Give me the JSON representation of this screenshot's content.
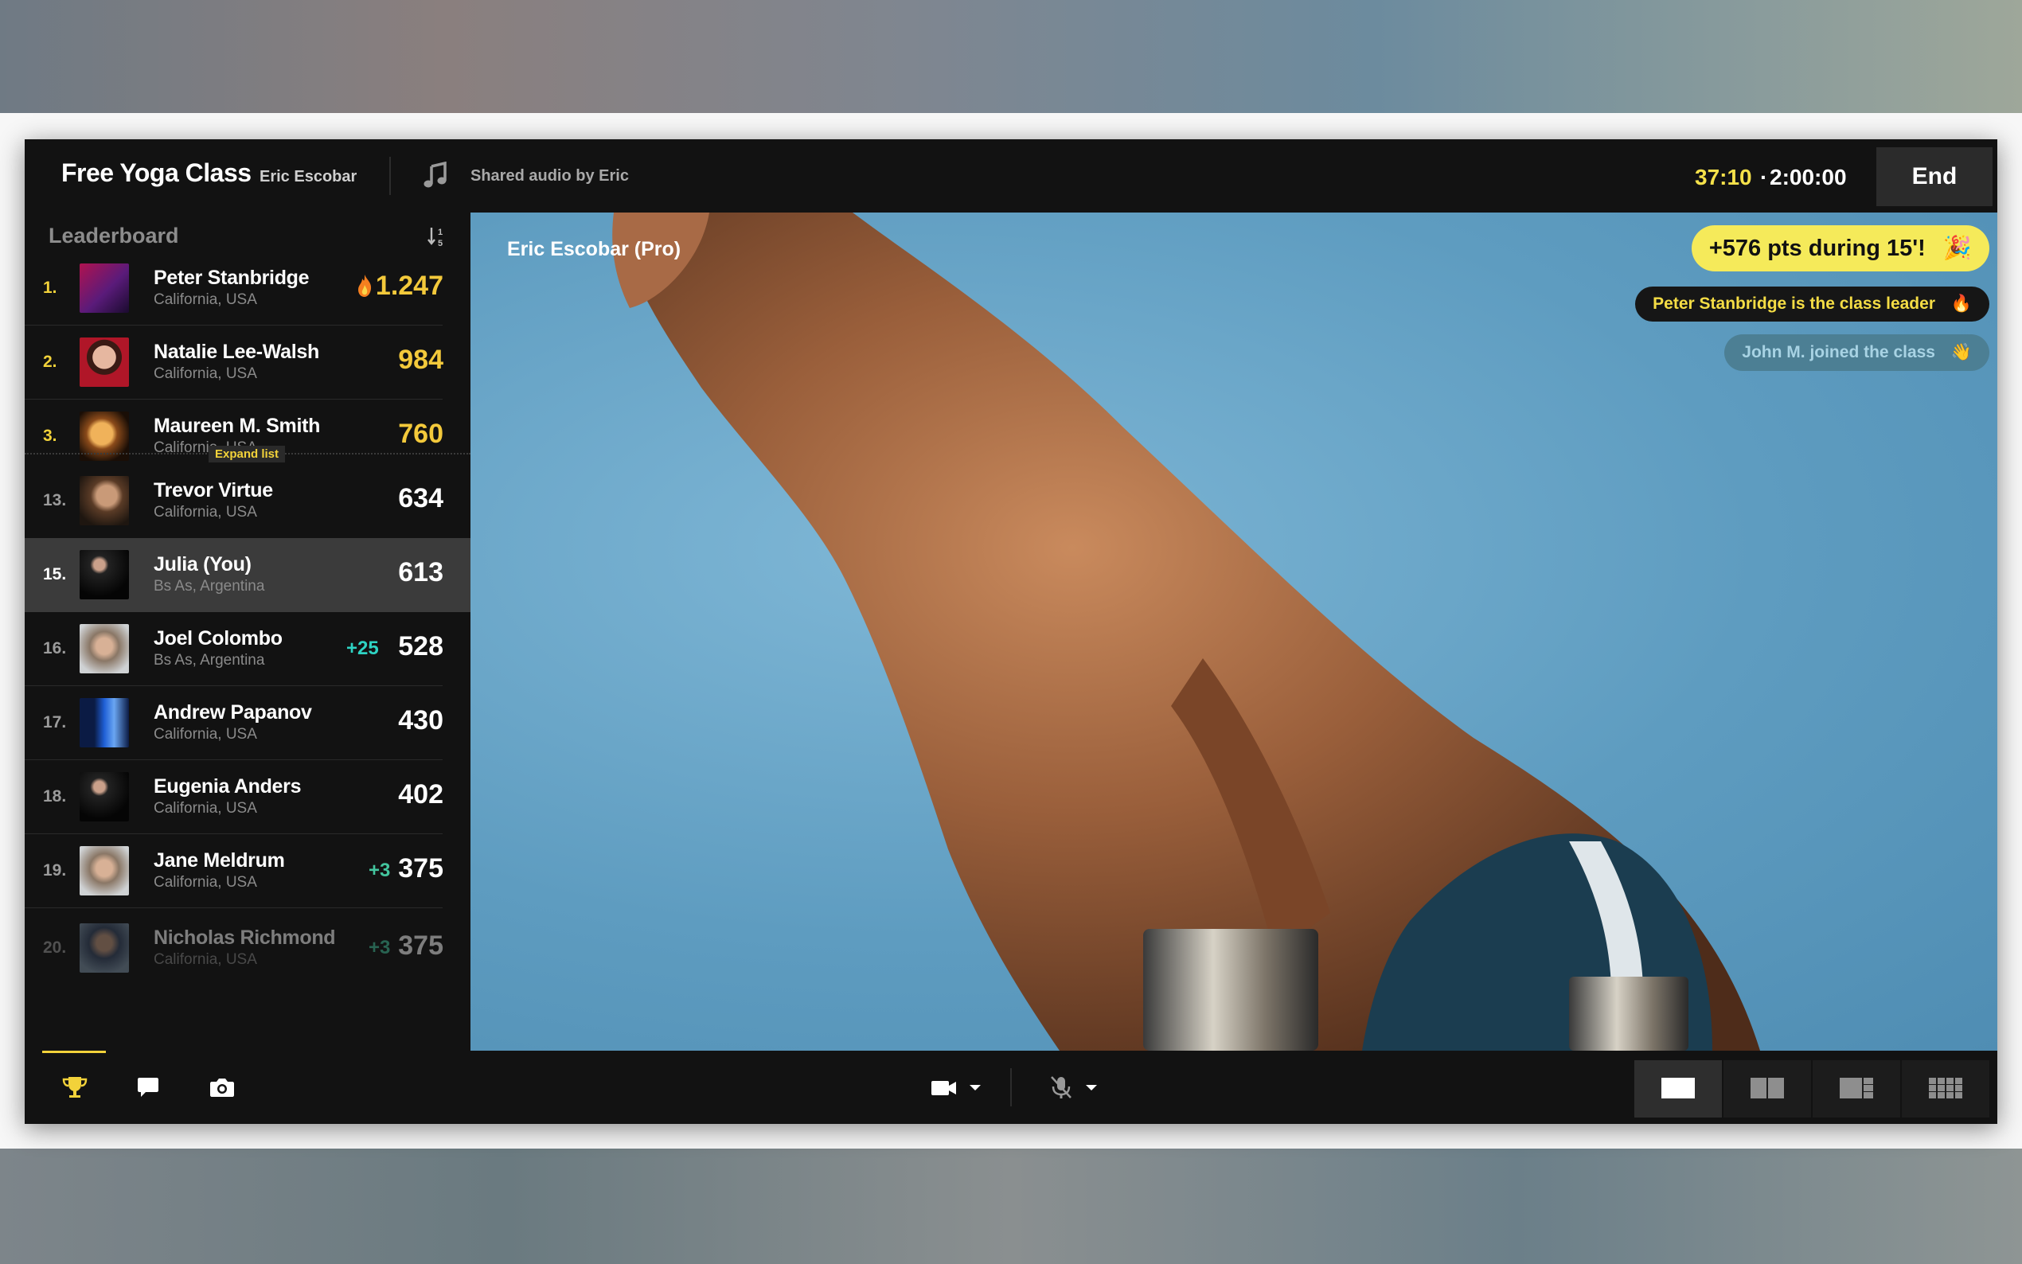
{
  "header": {
    "class_title": "Free Yoga Class",
    "instructor": "Eric Escobar",
    "audio": "Shared audio by Eric",
    "timer_elapsed": "37:10",
    "timer_separator": "·",
    "timer_total": "2:00:00",
    "end_label": "End"
  },
  "leaderboard": {
    "title": "Leaderboard",
    "expand_label": "Expand list",
    "rows": [
      {
        "rank": "1.",
        "name": "Peter Stanbridge",
        "location": "California, USA",
        "score": "1.247",
        "delta": ""
      },
      {
        "rank": "2.",
        "name": "Natalie Lee-Walsh",
        "location": "California, USA",
        "score": "984",
        "delta": ""
      },
      {
        "rank": "3.",
        "name": "Maureen M. Smith",
        "location": "California, USA",
        "score": "760",
        "delta": ""
      },
      {
        "rank": "13.",
        "name": "Trevor Virtue",
        "location": "California, USA",
        "score": "634",
        "delta": ""
      },
      {
        "rank": "15.",
        "name": "Julia (You)",
        "location": "Bs As, Argentina",
        "score": "613",
        "delta": ""
      },
      {
        "rank": "16.",
        "name": "Joel Colombo",
        "location": "Bs As, Argentina",
        "score": "528",
        "delta": "+25"
      },
      {
        "rank": "17.",
        "name": "Andrew Papanov",
        "location": "California, USA",
        "score": "430",
        "delta": ""
      },
      {
        "rank": "18.",
        "name": "Eugenia Anders",
        "location": "California, USA",
        "score": "402",
        "delta": ""
      },
      {
        "rank": "19.",
        "name": "Jane Meldrum",
        "location": "California, USA",
        "score": "375",
        "delta": "+3"
      },
      {
        "rank": "20.",
        "name": "Nicholas Richmond",
        "location": "California, USA",
        "score": "375",
        "delta": "+3"
      }
    ]
  },
  "video": {
    "presenter_label": "Eric Escobar (Pro)",
    "toasts": {
      "points": "+576 pts during 15'!",
      "leader": "Peter Stanbridge is the class leader",
      "join": "John M. joined the class"
    }
  },
  "colors": {
    "accent_yellow": "#f2d23a",
    "delta_teal": "#2ed3c3",
    "delta_green": "#43c59e"
  },
  "icons": [
    "music-note-icon",
    "sort-icon",
    "flame-icon",
    "trophy-icon",
    "chat-icon",
    "camera-icon",
    "video-camera-icon",
    "microphone-muted-icon",
    "chevron-down-icon",
    "party-popper-icon",
    "wave-icon"
  ]
}
